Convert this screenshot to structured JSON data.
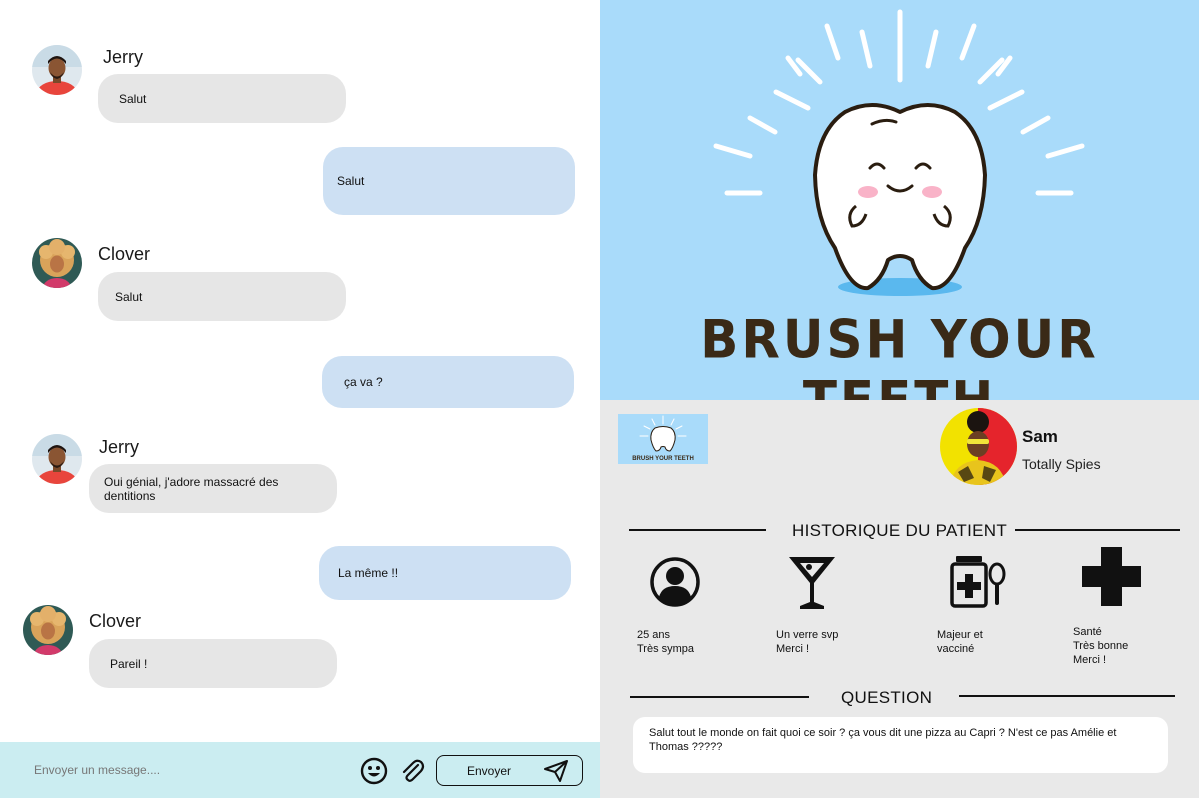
{
  "chat": {
    "messages": [
      {
        "type": "in",
        "sender": "Jerry",
        "avatar": "jerry-avatar",
        "text": "Salut"
      },
      {
        "type": "out",
        "text": "Salut"
      },
      {
        "type": "in",
        "sender": "Clover",
        "avatar": "clover-avatar",
        "text": "Salut"
      },
      {
        "type": "out",
        "text": "ça va ?"
      },
      {
        "type": "in",
        "sender": "Jerry",
        "avatar": "jerry-avatar",
        "text": "Oui génial, j'adore massacré des dentitions"
      },
      {
        "type": "out",
        "text": "La même !!"
      },
      {
        "type": "in",
        "sender": "Clover",
        "avatar": "clover-avatar",
        "text": "Pareil !"
      }
    ]
  },
  "composer": {
    "placeholder": "Envoyer un message....",
    "send_label": "Envoyer",
    "icons": [
      "emoji-icon",
      "paperclip-icon",
      "send-icon"
    ]
  },
  "banner": {
    "title": "BRUSH YOUR TEETH",
    "thumb_title": "BRUSH YOUR TEETH",
    "colors": {
      "sky": "#a9dbfa",
      "ink": "#3a2a17"
    }
  },
  "profile": {
    "name": "Sam",
    "subtitle": "Totally Spies"
  },
  "history": {
    "title": "HISTORIQUE DU PATIENT",
    "items": [
      {
        "icon": "user-icon",
        "line1": "25 ans",
        "line2": "Très sympa",
        "line3": ""
      },
      {
        "icon": "cocktail-icon",
        "line1": "Un verre svp",
        "line2": "Merci !",
        "line3": ""
      },
      {
        "icon": "medicine-icon",
        "line1": "Majeur et",
        "line2": "vacciné",
        "line3": ""
      },
      {
        "icon": "health-cross-icon",
        "line1": "Santé",
        "line2": "Très bonne",
        "line3": "Merci !"
      }
    ]
  },
  "question": {
    "title": "QUESTION",
    "text": "Salut tout le monde on fait quoi ce soir ? ça vous dit une pizza au Capri ? N'est ce pas Amélie et Thomas ?????"
  }
}
